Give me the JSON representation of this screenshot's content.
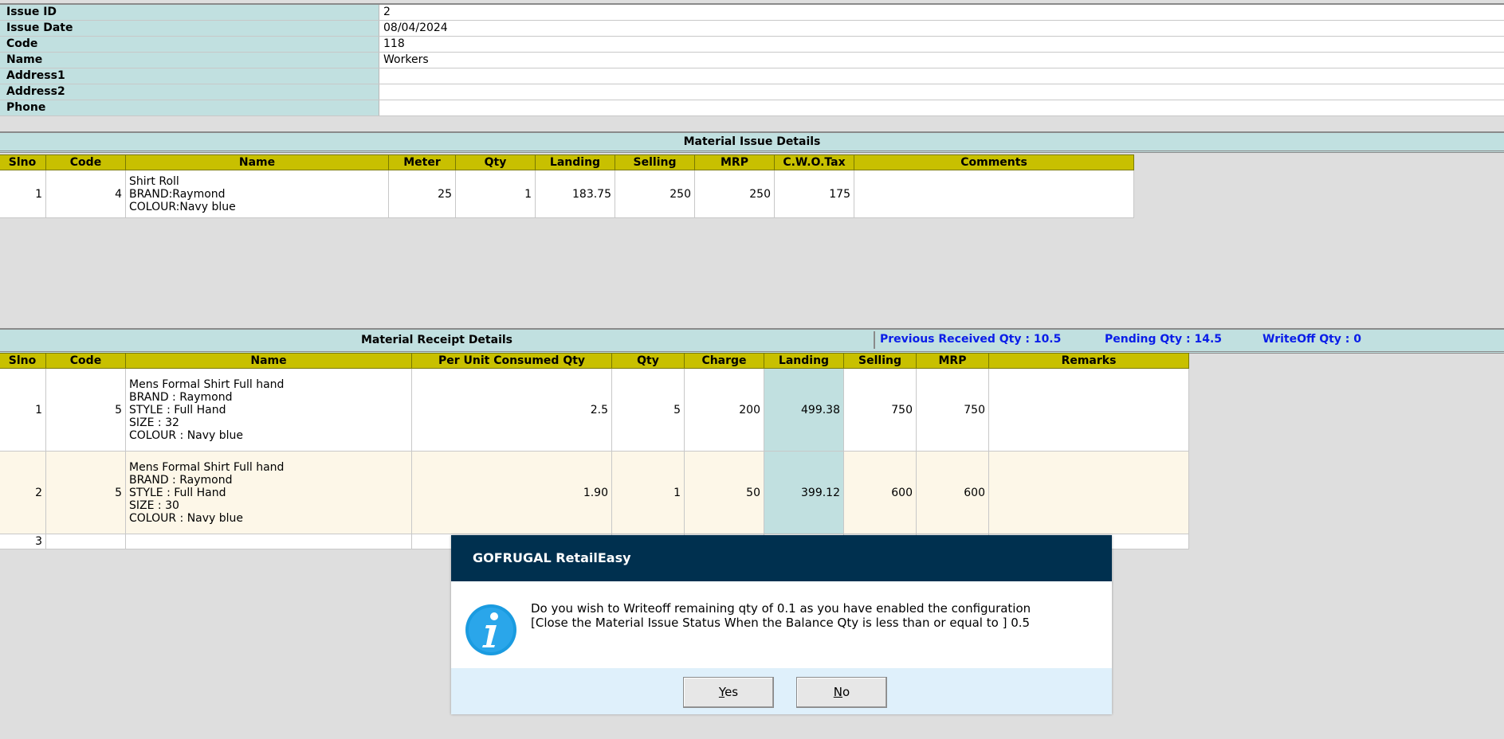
{
  "info": [
    {
      "label": "Issue ID",
      "value": "2"
    },
    {
      "label": "Issue Date",
      "value": "08/04/2024"
    },
    {
      "label": "Code",
      "value": "118"
    },
    {
      "label": "Name",
      "value": "Workers"
    },
    {
      "label": "Address1",
      "value": ""
    },
    {
      "label": "Address2",
      "value": ""
    },
    {
      "label": "Phone",
      "value": ""
    }
  ],
  "issue": {
    "title": "Material Issue Details",
    "headers": [
      "Slno",
      "Code",
      "Name",
      "Meter",
      "Qty",
      "Landing",
      "Selling",
      "MRP",
      "C.W.O.Tax",
      "Comments"
    ],
    "rows": [
      {
        "slno": "1",
        "code": "4",
        "name": [
          "Shirt Roll",
          "BRAND:Raymond",
          "COLOUR:Navy blue"
        ],
        "meter": "25",
        "qty": "1",
        "landing": "183.75",
        "selling": "250",
        "mrp": "250",
        "cwotax": "175",
        "comments": ""
      }
    ]
  },
  "receipt": {
    "title": "Material Receipt Details",
    "previous_received": "Previous Received Qty : 10.5",
    "pending": "Pending Qty : 14.5",
    "writeoff": "WriteOff Qty : 0",
    "headers": [
      "Slno",
      "Code",
      "Name",
      "Per Unit Consumed Qty",
      "Qty",
      "Charge",
      "Landing",
      "Selling",
      "MRP",
      "Remarks"
    ],
    "rows": [
      {
        "slno": "1",
        "code": "5",
        "name": [
          "Mens Formal Shirt Full hand",
          "BRAND : Raymond",
          "STYLE : Full Hand",
          "SIZE : 32",
          "COLOUR : Navy blue"
        ],
        "per_unit": "2.5",
        "qty": "5",
        "charge": "200",
        "landing": "499.38",
        "selling": "750",
        "mrp": "750",
        "remarks": ""
      },
      {
        "slno": "2",
        "code": "5",
        "name": [
          "Mens Formal Shirt Full hand",
          "BRAND : Raymond",
          "STYLE : Full Hand",
          "SIZE : 30",
          "COLOUR : Navy blue"
        ],
        "per_unit": "1.90",
        "qty": "1",
        "charge": "50",
        "landing": "399.12",
        "selling": "600",
        "mrp": "600",
        "remarks": ""
      },
      {
        "slno": "3",
        "code": "",
        "name": [],
        "per_unit": "",
        "qty": "",
        "charge": "",
        "landing": "",
        "selling": "",
        "mrp": "",
        "remarks": ""
      }
    ]
  },
  "dialog": {
    "title": "GOFRUGAL RetailEasy",
    "message_line1": "Do you wish to Writeoff remaining qty of 0.1 as you have enabled the configuration",
    "message_line2": "[Close the Material Issue Status When the Balance Qty is less than or equal to ] 0.5",
    "yes_mnemonic": "Y",
    "yes_rest": "es",
    "no_mnemonic": "N",
    "no_rest": "o",
    "icon": "info-icon"
  },
  "colors": {
    "teal": "#c1e0e0",
    "header_yellow": "#c8c000",
    "dialog_title_bg": "#00304f",
    "dialog_footer_bg": "#dff0fb",
    "info_text_blue": "#0a1ee8"
  }
}
